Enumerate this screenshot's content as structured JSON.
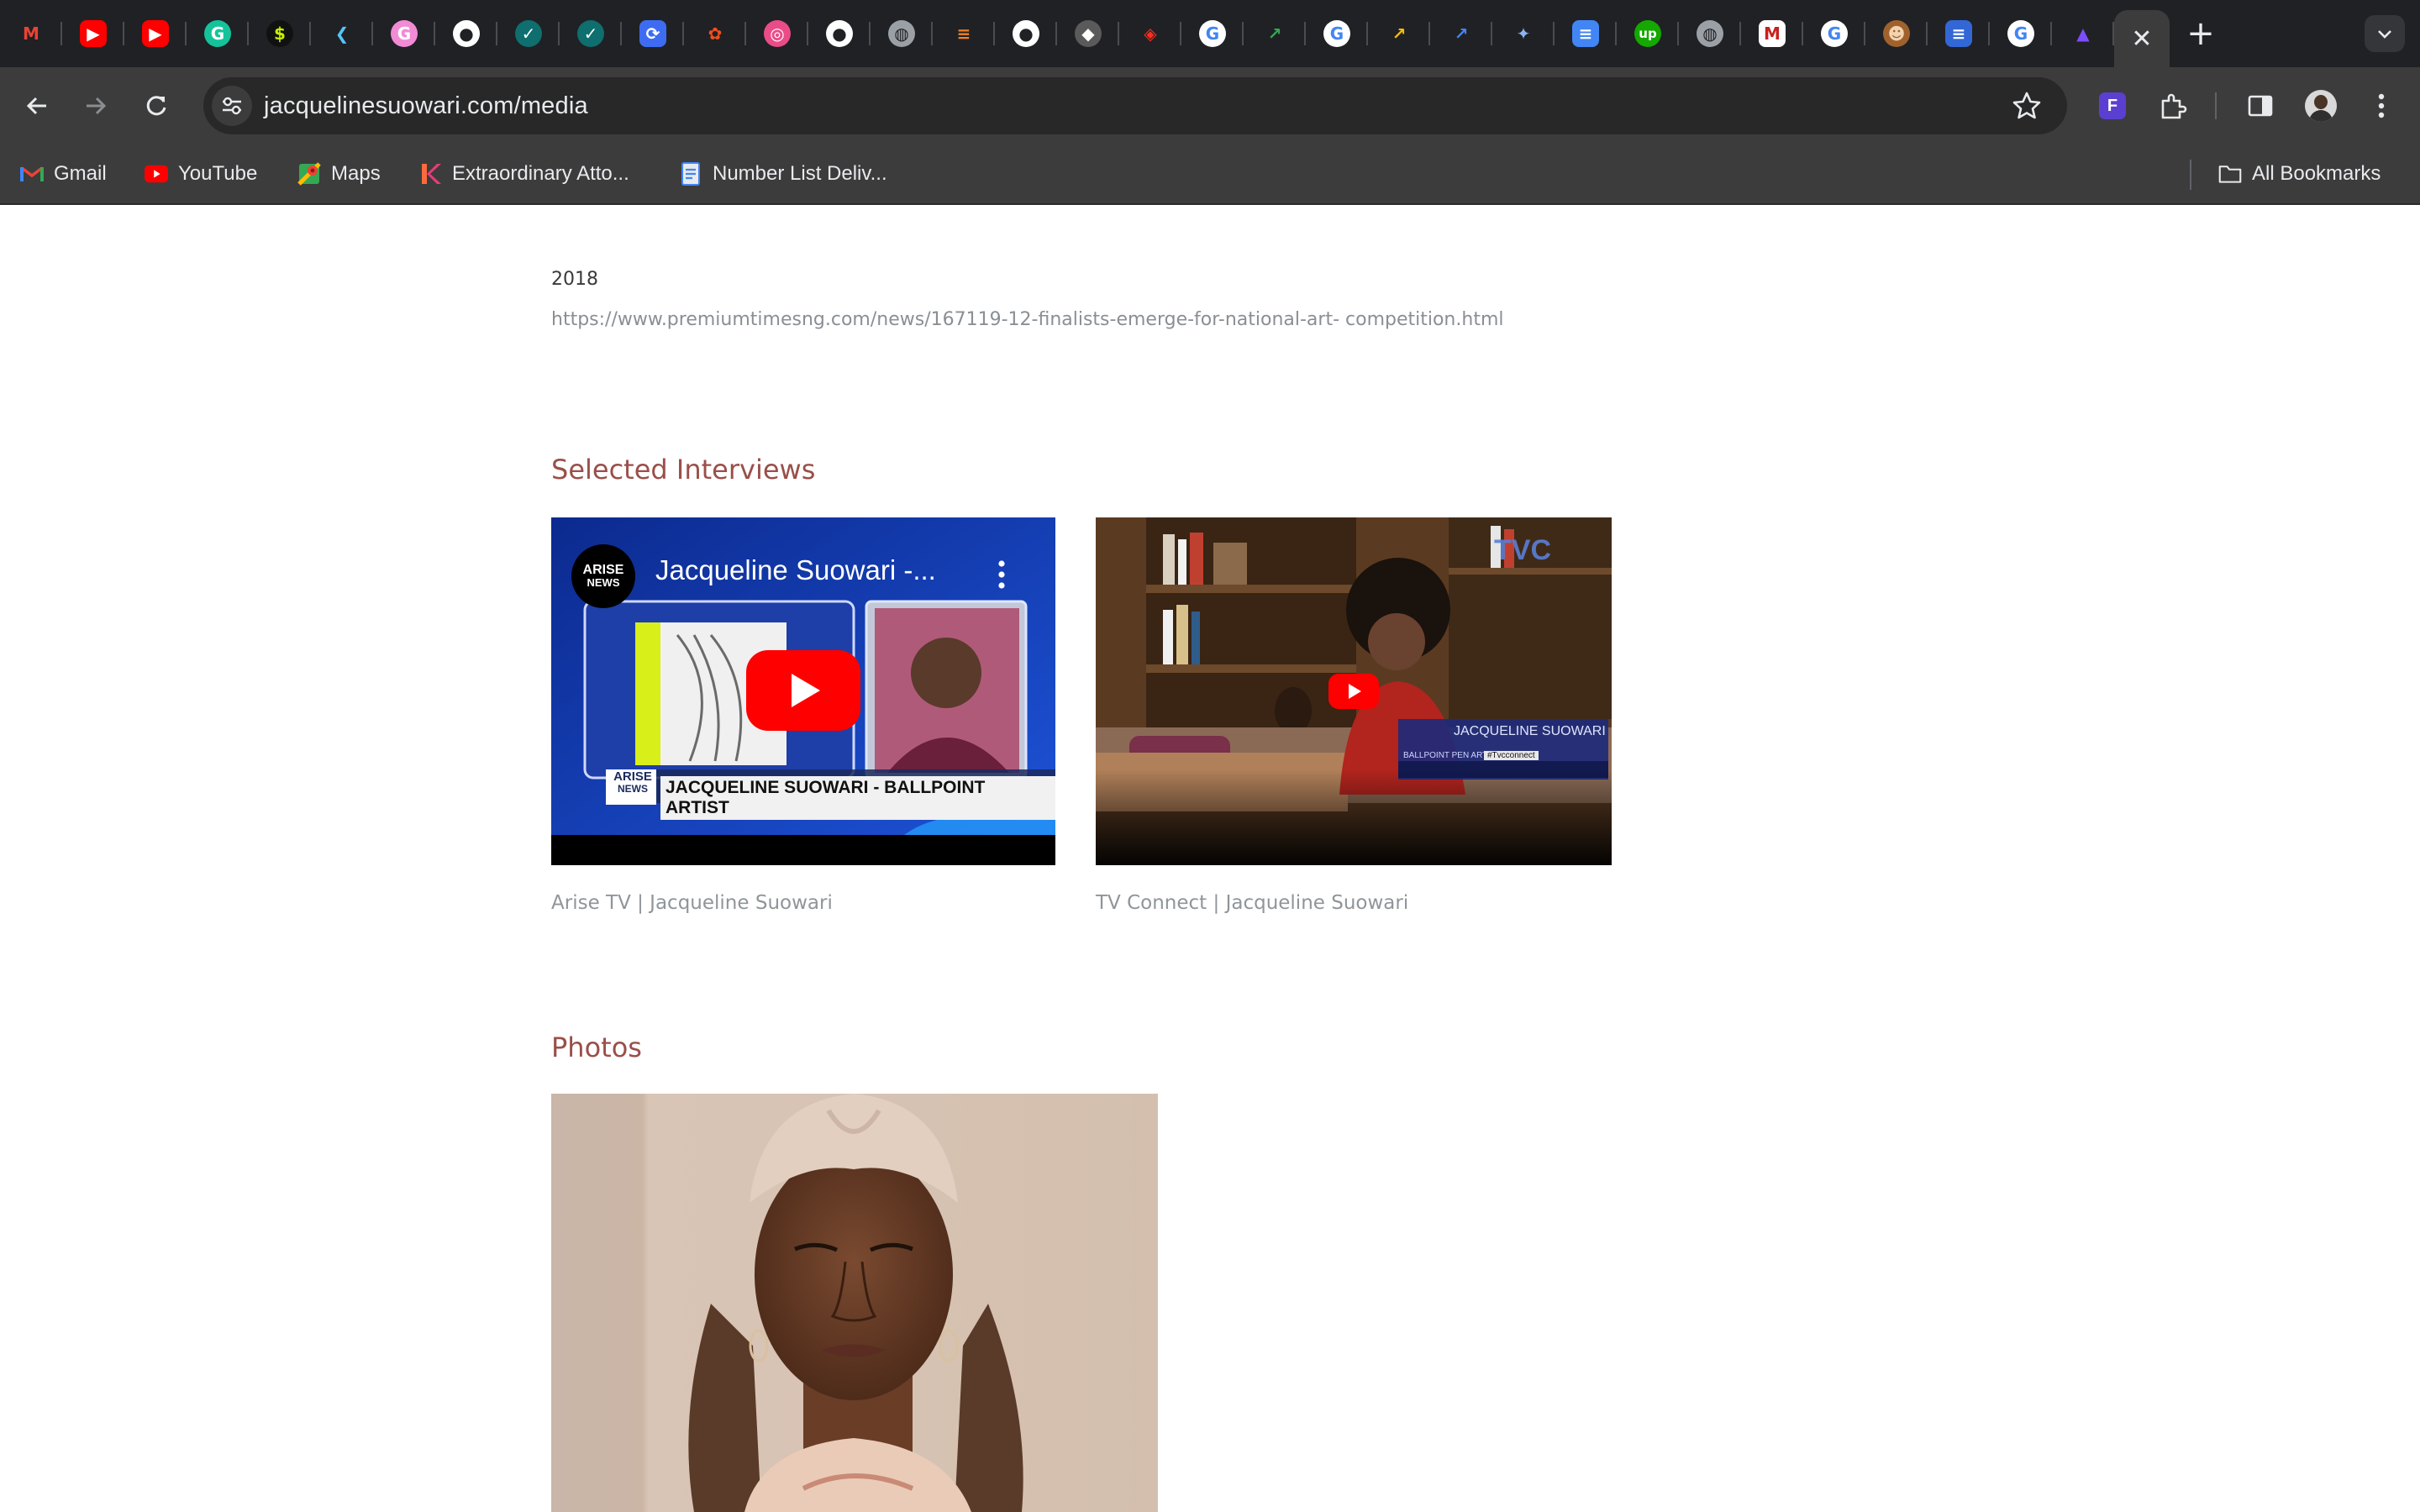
{
  "browser": {
    "tabs": [
      {
        "icon": "gmail-icon",
        "glyph": "M",
        "bg": "#202124",
        "fg": "#ea4335"
      },
      {
        "icon": "youtube-icon",
        "glyph": "▶",
        "bg": "#ff0000",
        "fg": "#ffffff"
      },
      {
        "icon": "youtube-icon",
        "glyph": "▶",
        "bg": "#ff0000",
        "fg": "#ffffff"
      },
      {
        "icon": "grammarly-icon",
        "glyph": "G",
        "bg": "#15c39a",
        "fg": "#ffffff",
        "round": true
      },
      {
        "icon": "dollar-icon",
        "glyph": "$",
        "bg": "#111111",
        "fg": "#c7f000",
        "round": true
      },
      {
        "icon": "flutter-icon",
        "glyph": "❮",
        "bg": "#202124",
        "fg": "#54c5f8"
      },
      {
        "icon": "gramarly-g-icon",
        "glyph": "G",
        "bg": "#f28bd6",
        "fg": "#ffffff",
        "round": true
      },
      {
        "icon": "github-icon",
        "glyph": "●",
        "bg": "#ffffff",
        "fg": "#202124",
        "round": true
      },
      {
        "icon": "check-icon",
        "glyph": "✓",
        "bg": "#0f6e6e",
        "fg": "#ffffff",
        "round": true
      },
      {
        "icon": "check-icon",
        "glyph": "✓",
        "bg": "#0f6e6e",
        "fg": "#ffffff",
        "round": true
      },
      {
        "icon": "sync-icon",
        "glyph": "⟳",
        "bg": "#3d6cf2",
        "fg": "#ffffff"
      },
      {
        "icon": "figma-icon",
        "glyph": "✿",
        "bg": "#202124",
        "fg": "#f24e1e"
      },
      {
        "icon": "dribbble-icon",
        "glyph": "◎",
        "bg": "#ea4c89",
        "fg": "#ffffff",
        "round": true
      },
      {
        "icon": "github-icon",
        "glyph": "●",
        "bg": "#ffffff",
        "fg": "#202124",
        "round": true
      },
      {
        "icon": "globe-icon",
        "glyph": "◍",
        "bg": "#9aa0a6",
        "fg": "#202124",
        "round": true
      },
      {
        "icon": "stackoverflow-icon",
        "glyph": "≡",
        "bg": "#202124",
        "fg": "#f48024"
      },
      {
        "icon": "github-icon",
        "glyph": "●",
        "bg": "#ffffff",
        "fg": "#202124",
        "round": true
      },
      {
        "icon": "notion-icon",
        "glyph": "◆",
        "bg": "#5a5a5a",
        "fg": "#ffffff",
        "round": true
      },
      {
        "icon": "laravel-icon",
        "glyph": "◈",
        "bg": "#202124",
        "fg": "#ff2d20"
      },
      {
        "icon": "google-icon",
        "glyph": "G",
        "bg": "#ffffff",
        "fg": "#4285f4",
        "round": true
      },
      {
        "icon": "trend-icon",
        "glyph": "↗",
        "bg": "#202124",
        "fg": "#34a853"
      },
      {
        "icon": "google-icon",
        "glyph": "G",
        "bg": "#ffffff",
        "fg": "#4285f4",
        "round": true
      },
      {
        "icon": "trend-icon",
        "glyph": "↗",
        "bg": "#202124",
        "fg": "#fbbc05"
      },
      {
        "icon": "trend-icon",
        "glyph": "↗",
        "bg": "#202124",
        "fg": "#4285f4"
      },
      {
        "icon": "gemini-icon",
        "glyph": "✦",
        "bg": "#202124",
        "fg": "#8ab4f8"
      },
      {
        "icon": "docs-icon",
        "glyph": "≡",
        "bg": "#4285f4",
        "fg": "#ffffff"
      },
      {
        "icon": "upwork-icon",
        "glyph": "up",
        "bg": "#14a800",
        "fg": "#ffffff",
        "round": true
      },
      {
        "icon": "globe-icon",
        "glyph": "◍",
        "bg": "#9aa0a6",
        "fg": "#202124",
        "round": true
      },
      {
        "icon": "medium-icon",
        "glyph": "M",
        "bg": "#ffffff",
        "fg": "#c5221f"
      },
      {
        "icon": "google-icon",
        "glyph": "G",
        "bg": "#ffffff",
        "fg": "#4285f4",
        "round": true
      },
      {
        "icon": "avatar-icon",
        "glyph": "☻",
        "bg": "#a0622d",
        "fg": "#f3d3b0",
        "round": true
      },
      {
        "icon": "docs-icon",
        "glyph": "≡",
        "bg": "#3367d6",
        "fg": "#ffffff"
      },
      {
        "icon": "google-icon",
        "glyph": "G",
        "bg": "#ffffff",
        "fg": "#4285f4",
        "round": true
      },
      {
        "icon": "triangle-icon",
        "glyph": "▲",
        "bg": "#202124",
        "fg": "#7c4dff"
      }
    ],
    "url": "jacquelinesuowari.com/media",
    "bookmarks": [
      {
        "label": "Gmail",
        "icon": "gmail-icon"
      },
      {
        "label": "YouTube",
        "icon": "youtube-icon"
      },
      {
        "label": "Maps",
        "icon": "maps-icon"
      },
      {
        "label": "Extraordinary Atto...",
        "icon": "kdrama-icon"
      },
      {
        "label": "Number List Deliv...",
        "icon": "doc-icon"
      }
    ],
    "all_bookmarks": "All Bookmarks"
  },
  "page": {
    "year": "2018",
    "article_link": "https://www.premiumtimesng.com/news/167119-12-finalists-emerge-for-national-art- competition.html",
    "interviews": {
      "title": "Selected Interviews",
      "videos": [
        {
          "caption": "Arise TV | Jacqueline Suowari",
          "video_title": "Jacqueline Suowari -...",
          "channel": "ARISE NEWS",
          "channel_line1": "ARISE",
          "channel_line2": "NEWS",
          "lower_third": "JACQUELINE SUOWARI - BALLPOINT ARTIST"
        },
        {
          "caption": "TV Connect | Jacqueline Suowari",
          "channel": "TVC",
          "lower_third": "JACQUELINE SUOWARI",
          "lower_third_sub": "BALLPOINT PEN ARTIST",
          "lower_third_handle": "#Tvcconnect"
        }
      ]
    },
    "photos": {
      "title": "Photos"
    }
  },
  "colors": {
    "section_title": "#9a4f4a",
    "link_gray": "#8a8f94",
    "chrome_dark": "#202124",
    "chrome_toolbar": "#3c3c3c"
  }
}
